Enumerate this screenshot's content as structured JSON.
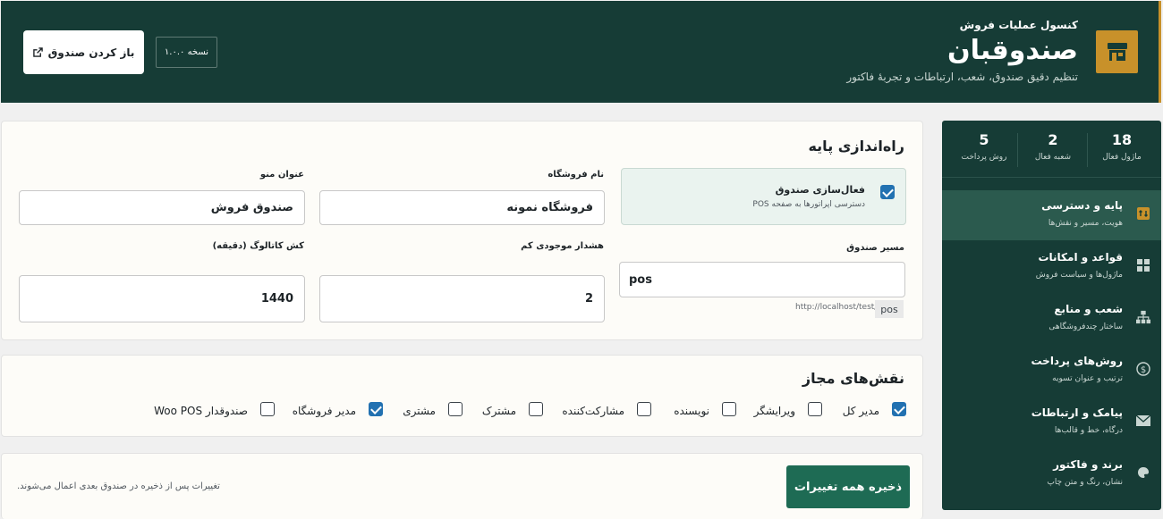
{
  "header": {
    "kicker": "کنسول عملیات فروش",
    "title": "صندوقبان",
    "subtitle": "تنظیم دقیق صندوق، شعب، ارتباطات و تجربهٔ فاکتور",
    "open_button": "باز کردن صندوق",
    "version": "نسخه ۱.۰.۰"
  },
  "stats": [
    {
      "value": "18",
      "label": "ماژول فعال"
    },
    {
      "value": "2",
      "label": "شعبه فعال"
    },
    {
      "value": "5",
      "label": "روش پرداخت"
    }
  ],
  "nav": [
    {
      "title": "پایه و دسترسی",
      "subtitle": "هویت، مسیر و نقش‌ها",
      "icon": "key-icon",
      "active": true
    },
    {
      "title": "قواعد و امکانات",
      "subtitle": "ماژول‌ها و سیاست فروش",
      "icon": "grid-icon",
      "active": false
    },
    {
      "title": "شعب و منابع",
      "subtitle": "ساختار چندفروشگاهی",
      "icon": "hierarchy-icon",
      "active": false
    },
    {
      "title": "روش‌های پرداخت",
      "subtitle": "ترتیب و عنوان تسویه",
      "icon": "dollar-icon",
      "active": false
    },
    {
      "title": "پیامک و ارتباطات",
      "subtitle": "درگاه، خط و قالب‌ها",
      "icon": "envelope-icon",
      "active": false
    },
    {
      "title": "برند و فاکتور",
      "subtitle": "نشان، رنگ و متن چاپ",
      "icon": "palette-icon",
      "active": false
    }
  ],
  "basic": {
    "title": "راه‌اندازی پایه",
    "activate_label": "فعال‌سازی صندوق",
    "activate_desc": "دسترسی اپراتورها به صفحه POS",
    "activate_checked": true,
    "store_name_label": "نام فروشگاه",
    "store_name_value": "فروشگاه نمونه",
    "menu_title_label": "عنوان منو",
    "menu_title_value": "صندوق فروش",
    "pos_path_label": "مسیر صندوق",
    "pos_path_value": "pos",
    "url_prefix": "http://localhost/test/",
    "url_suffix": "pos",
    "low_stock_label": "هشدار موجودی کم",
    "low_stock_value": "2",
    "catalog_cache_label": "کش کاتالوگ (دقیقه)",
    "catalog_cache_value": "1440"
  },
  "roles": {
    "title": "نقش‌های مجاز",
    "items": [
      {
        "label": "مدیر کل",
        "checked": true
      },
      {
        "label": "ویرایشگر",
        "checked": false
      },
      {
        "label": "نویسنده",
        "checked": false
      },
      {
        "label": "مشارکت‌کننده",
        "checked": false
      },
      {
        "label": "مشترک",
        "checked": false
      },
      {
        "label": "مشتری",
        "checked": false
      },
      {
        "label": "مدیر فروشگاه",
        "checked": true
      },
      {
        "label": "صندوقدار Woo POS",
        "checked": false
      }
    ]
  },
  "footer": {
    "save_button": "ذخیره همه تغییرات",
    "note": "تغییرات پس از ذخیره در صندوق بعدی اعمال می‌شوند."
  },
  "colors": {
    "header_bg": "#163c36",
    "accent": "#c8912a",
    "primary": "#1e6b54",
    "checkbox": "#2271b1"
  }
}
